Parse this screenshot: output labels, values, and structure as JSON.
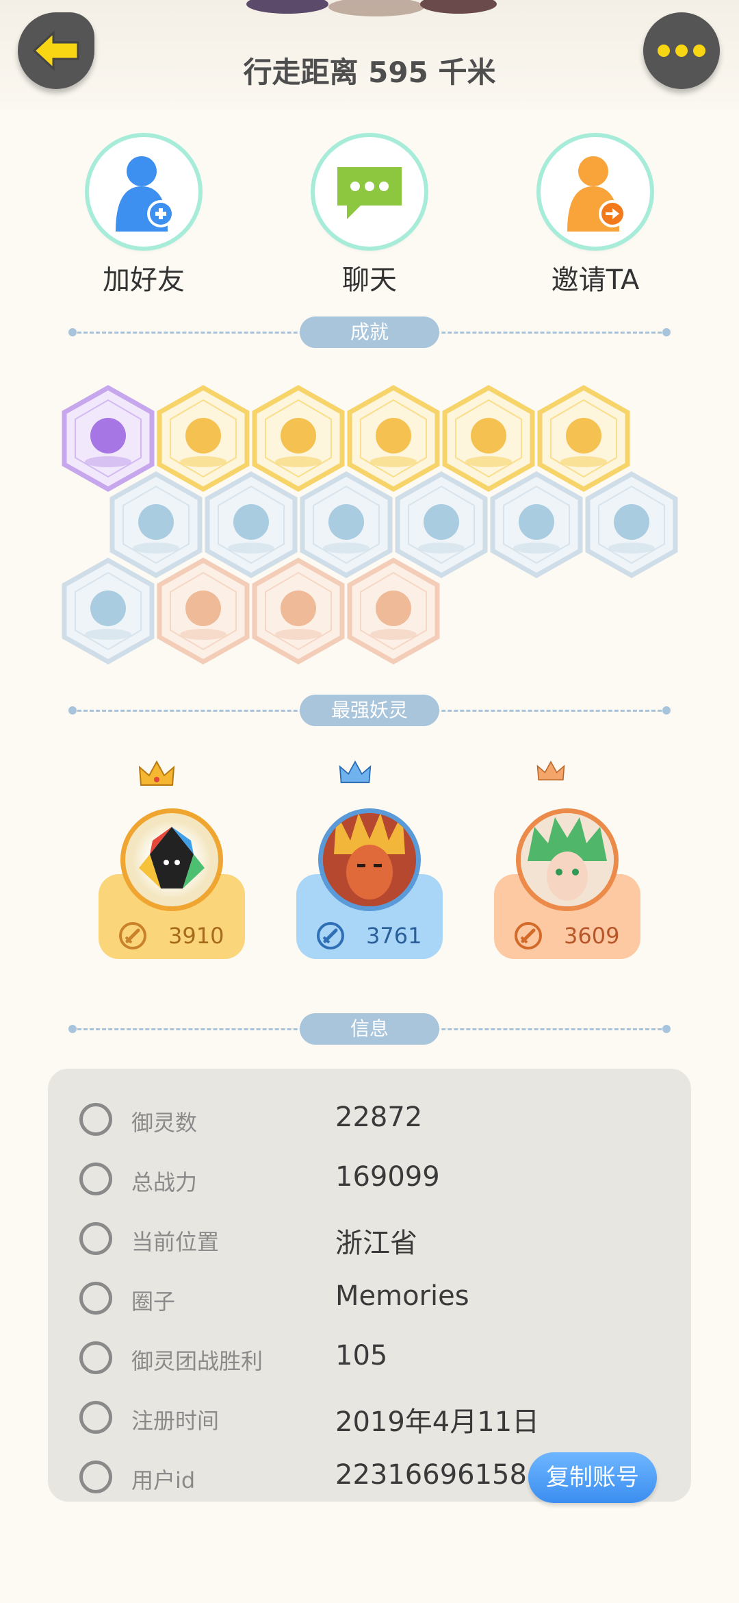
{
  "header": {
    "walk_distance": "行走距离 595 千米"
  },
  "actions": [
    {
      "label": "加好友",
      "icon": "add-friend-icon"
    },
    {
      "label": "聊天",
      "icon": "chat-icon"
    },
    {
      "label": "邀请TA",
      "icon": "invite-icon"
    }
  ],
  "sections": {
    "achievements": "成就",
    "strongest": "最强妖灵",
    "info": "信息"
  },
  "achievements": [
    {
      "name": "purple-spirit-badge",
      "tier": "purple"
    },
    {
      "name": "sun-badge",
      "tier": "gold"
    },
    {
      "name": "orb-badge",
      "tier": "gold"
    },
    {
      "name": "yinyang-swirl-badge",
      "tier": "gold"
    },
    {
      "name": "yinyang-book-badge",
      "tier": "gold"
    },
    {
      "name": "fox-book-badge",
      "tier": "gold"
    },
    {
      "name": "shoe-badge",
      "tier": "blue"
    },
    {
      "name": "moon-badge",
      "tier": "blue"
    },
    {
      "name": "crystal-badge",
      "tier": "blue"
    },
    {
      "name": "ghost-badge",
      "tier": "blue"
    },
    {
      "name": "cat-wand-badge",
      "tier": "blue"
    },
    {
      "name": "shield-badge",
      "tier": "blue"
    },
    {
      "name": "horned-statue-badge",
      "tier": "blue"
    },
    {
      "name": "cart-badge",
      "tier": "peach"
    },
    {
      "name": "deer-badge",
      "tier": "peach"
    },
    {
      "name": "cat-duo-badge",
      "tier": "peach"
    }
  ],
  "spirits": [
    {
      "power": "3910",
      "theme": "gold",
      "crown": "gold-crown"
    },
    {
      "power": "3761",
      "theme": "blue",
      "crown": "blue-crown"
    },
    {
      "power": "3609",
      "theme": "orange",
      "crown": "orange-crown"
    }
  ],
  "info": {
    "rows": [
      {
        "key": "御灵数",
        "value": "22872",
        "icon": "spirit-count-icon"
      },
      {
        "key": "总战力",
        "value": "169099",
        "icon": "sword-icon"
      },
      {
        "key": "当前位置",
        "value": "浙江省",
        "icon": "location-icon"
      },
      {
        "key": "圈子",
        "value": "Memories",
        "icon": "circle-icon"
      },
      {
        "key": "御灵团战胜利",
        "value": "105",
        "icon": "trophy-icon"
      },
      {
        "key": "注册时间",
        "value": "2019年4月11日",
        "icon": "clock-icon"
      },
      {
        "key": "用户id",
        "value": "22316696158",
        "icon": "id-card-icon"
      }
    ],
    "copy_button": "复制账号"
  },
  "colors": {
    "background": "#fcfaf3",
    "section_pill": "#a8c5db",
    "gold": "#fbd57a",
    "blue": "#a9d6f7",
    "orange": "#fdc9a2",
    "copy_button": "#4a9df5",
    "back_arrow": "#f8d613"
  }
}
